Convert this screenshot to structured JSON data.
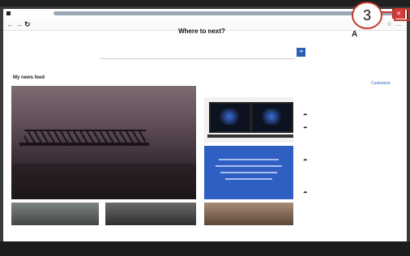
{
  "window": {
    "tab_title": "",
    "close_glyph": "✕"
  },
  "toolbar": {
    "back_icon": "back-arrow-icon",
    "forward_icon": "forward-arrow-icon",
    "refresh_icon": "refresh-icon",
    "favorites_icon": "star-icon",
    "menu_icon": "ellipsis-icon"
  },
  "page": {
    "heading": "Where to next?",
    "user_initial": "A",
    "search_placeholder": "",
    "search_button_icon": "search-icon"
  },
  "news": {
    "title": "My news feed",
    "subtitle": "",
    "customize": "Customize"
  },
  "annotation": {
    "number": "3",
    "color": "#c0392b"
  },
  "colors": {
    "accent": "#2b5fb6",
    "close": "#d93a3a"
  }
}
